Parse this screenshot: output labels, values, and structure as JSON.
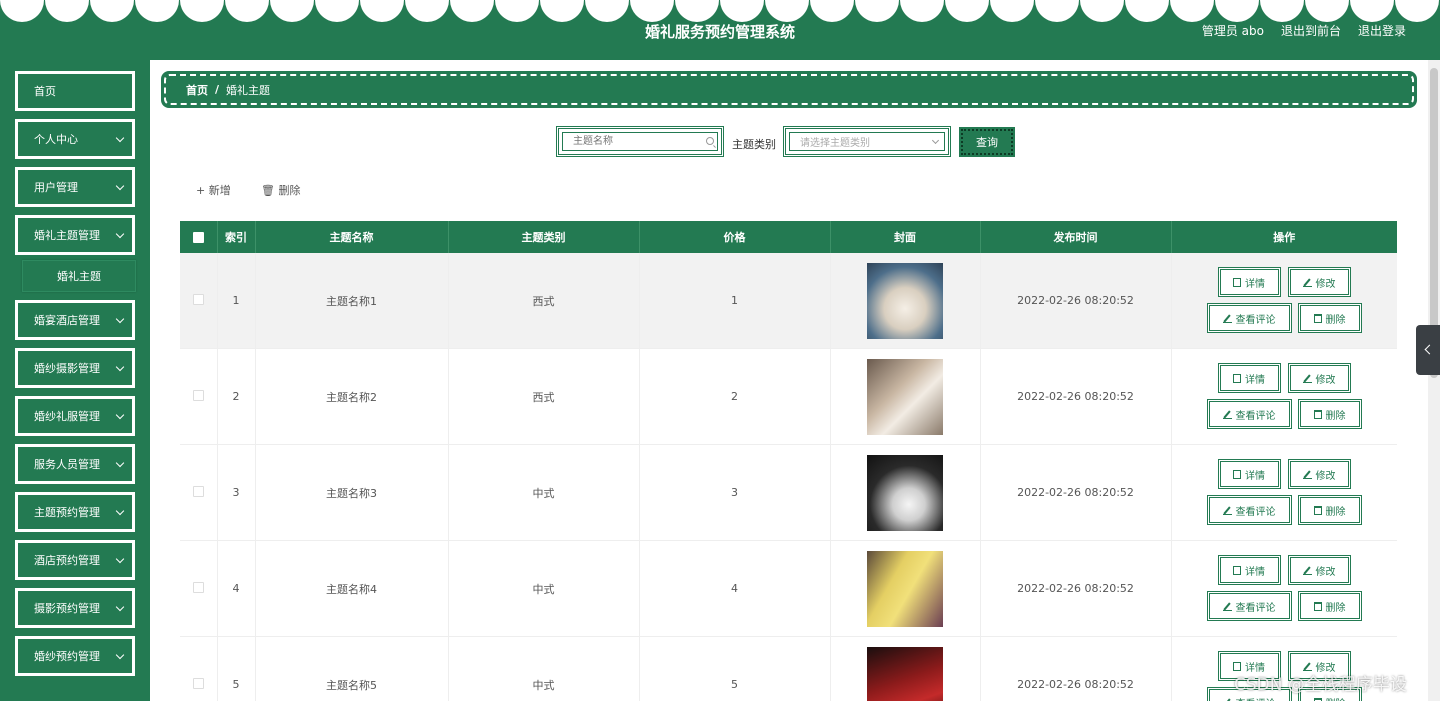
{
  "header": {
    "title": "婚礼服务预约管理系统",
    "admin": "管理员 abo",
    "to_front": "退出到前台",
    "logout": "退出登录"
  },
  "sidebar": {
    "items": [
      {
        "label": "首页",
        "has_sub": false
      },
      {
        "label": "个人中心",
        "has_sub": true
      },
      {
        "label": "用户管理",
        "has_sub": true
      },
      {
        "label": "婚礼主题管理",
        "has_sub": true
      },
      {
        "label": "婚宴酒店管理",
        "has_sub": true
      },
      {
        "label": "婚纱摄影管理",
        "has_sub": true
      },
      {
        "label": "婚纱礼服管理",
        "has_sub": true
      },
      {
        "label": "服务人员管理",
        "has_sub": true
      },
      {
        "label": "主题预约管理",
        "has_sub": true
      },
      {
        "label": "酒店预约管理",
        "has_sub": true
      },
      {
        "label": "摄影预约管理",
        "has_sub": true
      },
      {
        "label": "婚纱预约管理",
        "has_sub": true
      }
    ],
    "sub_item": "婚礼主题"
  },
  "breadcrumb": {
    "home": "首页",
    "sep": "/",
    "current": "婚礼主题"
  },
  "search": {
    "name_placeholder": "主题名称",
    "type_label": "主题类别",
    "type_placeholder": "请选择主题类别",
    "query_button": "查询"
  },
  "actions": {
    "add": "+ 新增",
    "delete": "删除"
  },
  "table": {
    "headers": [
      "",
      "索引",
      "主题名称",
      "主题类别",
      "价格",
      "封面",
      "发布时间",
      "操作"
    ],
    "rows": [
      {
        "index": "1",
        "name": "主题名称1",
        "type": "西式",
        "price": "1",
        "time": "2022-02-26 08:20:52",
        "cover": "cover-1"
      },
      {
        "index": "2",
        "name": "主题名称2",
        "type": "西式",
        "price": "2",
        "time": "2022-02-26 08:20:52",
        "cover": "cover-2"
      },
      {
        "index": "3",
        "name": "主题名称3",
        "type": "中式",
        "price": "3",
        "time": "2022-02-26 08:20:52",
        "cover": "cover-3"
      },
      {
        "index": "4",
        "name": "主题名称4",
        "type": "中式",
        "price": "4",
        "time": "2022-02-26 08:20:52",
        "cover": "cover-4"
      },
      {
        "index": "5",
        "name": "主题名称5",
        "type": "中式",
        "price": "5",
        "time": "2022-02-26 08:20:52",
        "cover": "cover-5"
      }
    ],
    "ops": {
      "detail": "详情",
      "edit": "修改",
      "comments": "查看评论",
      "delete": "删除"
    }
  },
  "watermark": "CSDN @全栈程序毕设",
  "colors": {
    "primary": "#237a52",
    "text": "#555555"
  }
}
